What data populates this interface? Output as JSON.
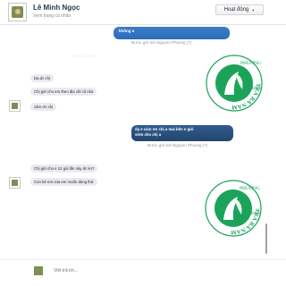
{
  "header": {
    "name": "Lê Minh Ngọc",
    "subtitle": "Xem trang cá nhân",
    "status_label": "Hoạt động",
    "status_caret": "▼"
  },
  "conversation": {
    "out_top": {
      "text": "không a",
      "seen": "Được gửi bởi Nguyen Phuong  (?)"
    },
    "timestamp": "LÚC 11:14",
    "incoming_1": [
      {
        "text": "Dạ dc chị"
      },
      {
        "text": "Chị gửi cho em theo địa chỉ cũ nha"
      }
    ],
    "incoming_1b": {
      "text": "cảm ơn chị"
    },
    "out_mid": {
      "line1": "dạ e cảm ơn chị a mai bên e gửi",
      "line2": "sớm cho chị a",
      "seen": "Được gửi bởi Nguyen Phuong  (?)"
    },
    "incoming_2": [
      {
        "text": "Chị gửi cho e 12 gói lần này dc ko?"
      },
      {
        "text": "Con bé em của em muốn dùng thử"
      }
    ]
  },
  "logo": {
    "ring_text": "TRÀ BÁ NAM",
    "ring_text_right": "PHUƠNG",
    "ring_text_bottom": "ĐƠN"
  },
  "composer": {
    "placeholder": "Viết trả lời..."
  },
  "colors": {
    "accent": "#2b6dba",
    "logo_green": "#1ca35a"
  }
}
